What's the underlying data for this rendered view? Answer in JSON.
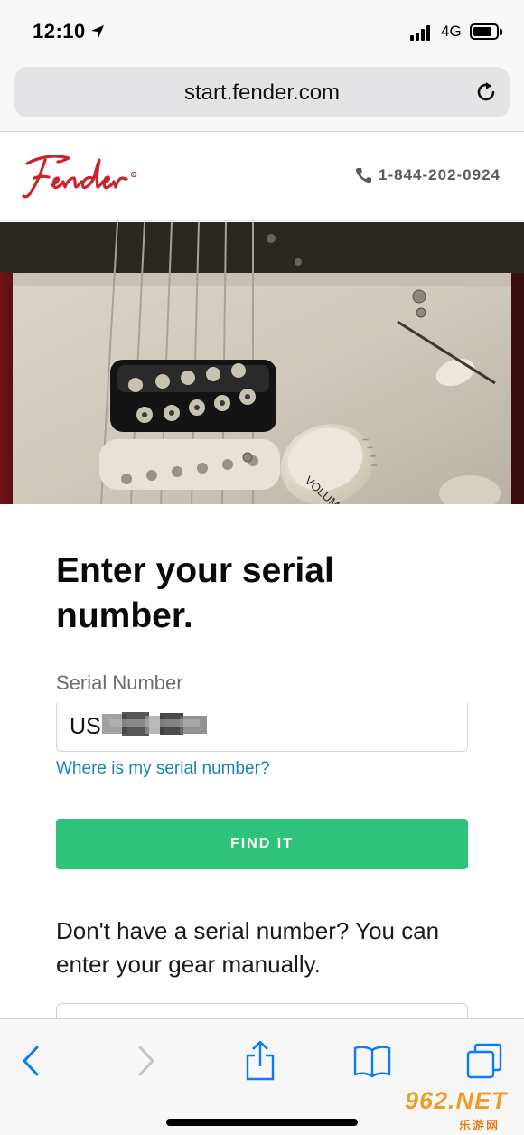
{
  "status_bar": {
    "time": "12:10",
    "network": "4G"
  },
  "browser": {
    "url": "start.fender.com"
  },
  "header": {
    "brand": "Fender",
    "phone": "1-844-202-0924"
  },
  "hero": {
    "knob_label": "VOLUME"
  },
  "form": {
    "title": "Enter your serial number.",
    "serial_label": "Serial Number",
    "serial_value": "US",
    "help_link": "Where is my serial number?",
    "submit_label": "FIND IT",
    "manual_prompt": "Don't have a serial number? You can enter your gear manually."
  },
  "watermark": {
    "top": "962.NET",
    "bottom": "乐游网"
  },
  "colors": {
    "brand_red": "#cc2229",
    "button_green": "#2ec27a",
    "link_blue": "#1a84b6",
    "ios_blue": "#0a7aff"
  }
}
